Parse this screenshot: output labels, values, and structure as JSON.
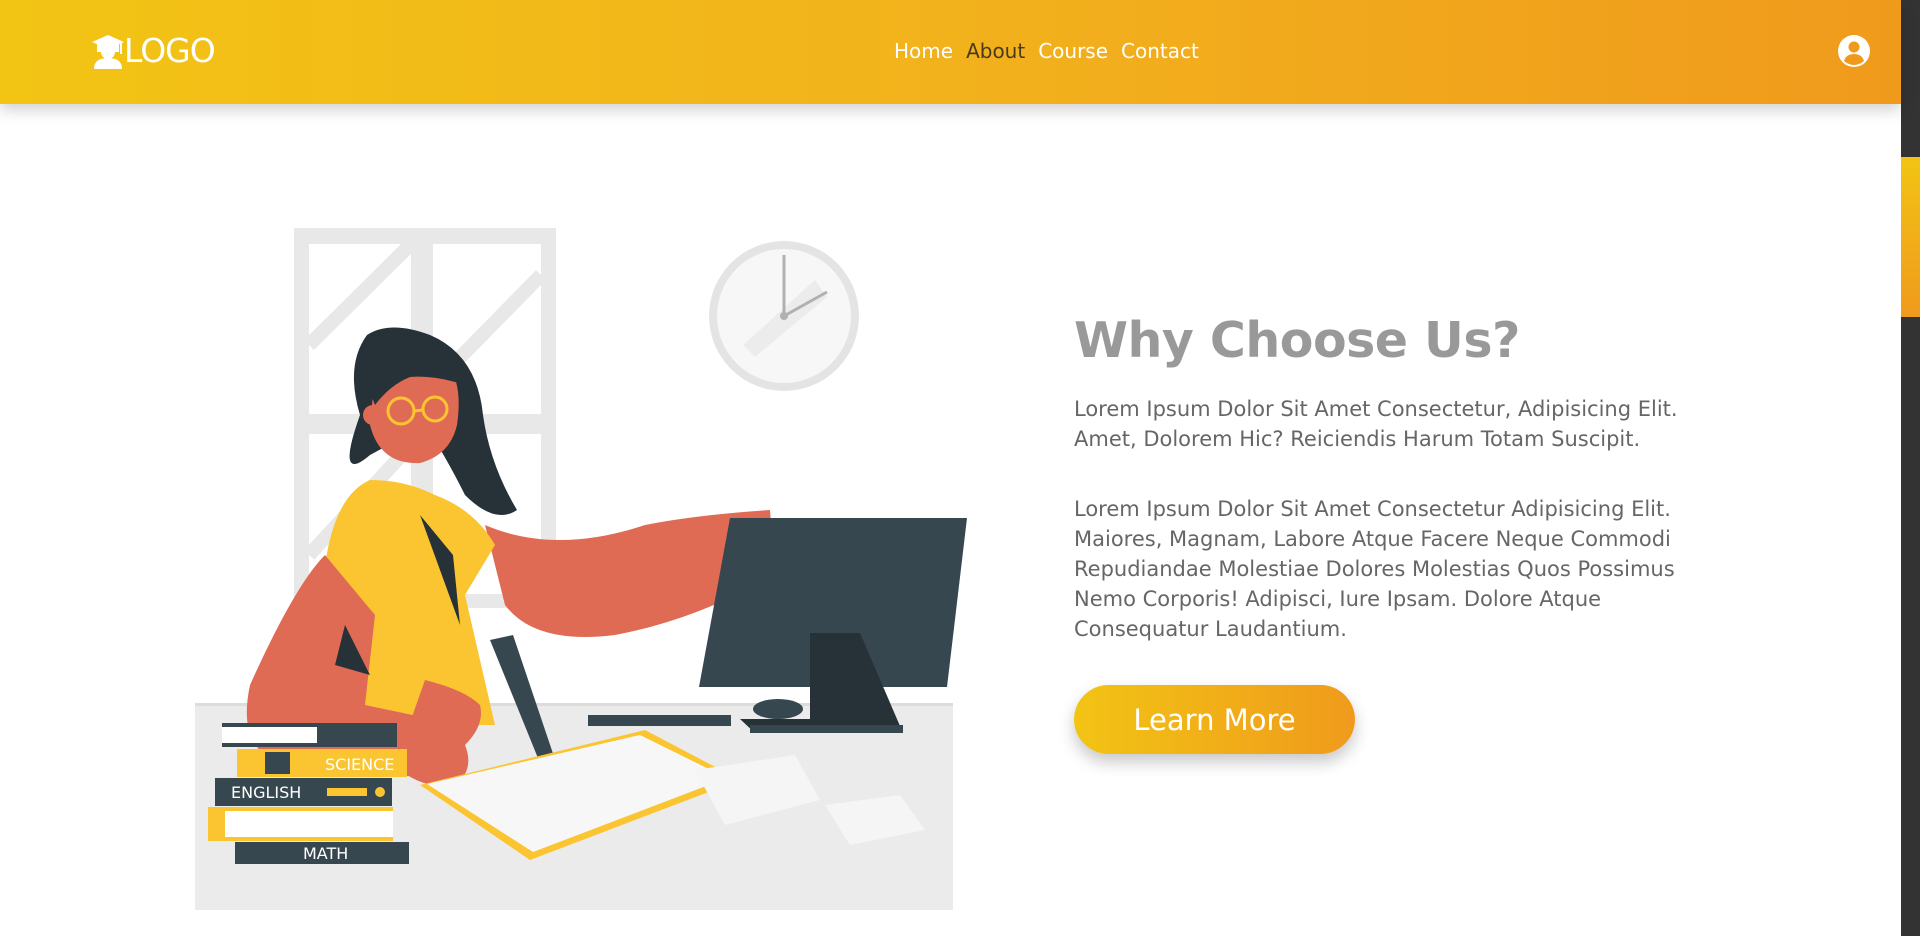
{
  "header": {
    "logo_text": "LOGO",
    "logo_icon": "graduate-icon",
    "nav": [
      {
        "label": "Home"
      },
      {
        "label": "About"
      },
      {
        "label": "Course"
      },
      {
        "label": "Contact"
      }
    ],
    "user_icon": "user-circle-icon"
  },
  "colors": {
    "gradient_start": "#f2c414",
    "gradient_end": "#f09a1c",
    "title": "#999999",
    "text": "#666666",
    "skin": "#e06b55",
    "shirt": "#fbc531",
    "dark": "#37474f"
  },
  "illustration": {
    "books": [
      "SCIENCE",
      "ENGLISH",
      "MATH"
    ]
  },
  "main": {
    "title": "Why Choose Us?",
    "paragraph1": "Lorem Ipsum Dolor Sit Amet Consectetur, Adipisicing Elit. Amet, Dolorem Hic? Reiciendis Harum Totam Suscipit.",
    "paragraph2": "Lorem Ipsum Dolor Sit Amet Consectetur Adipisicing Elit. Maiores, Magnam, Labore Atque Facere Neque Commodi Repudiandae Molestiae Dolores Molestias Quos Possimus Nemo Corporis! Adipisci, Iure Ipsam. Dolore Atque Consequatur Laudantium.",
    "button_label": "Learn More"
  }
}
